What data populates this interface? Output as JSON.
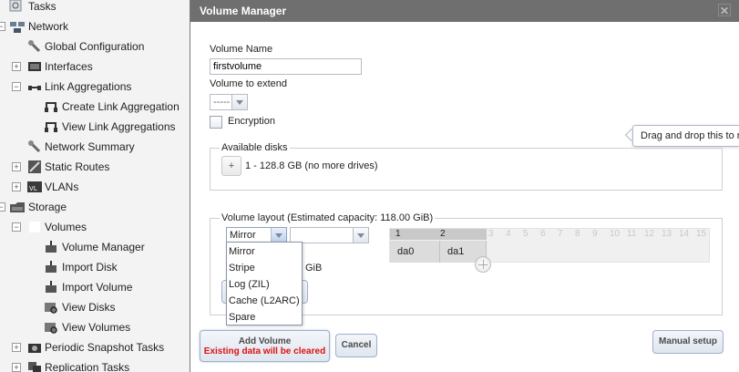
{
  "tree": {
    "items": [
      {
        "label": "Tasks",
        "icon": "tasks-icon"
      },
      {
        "label": "Network",
        "icon": "network-icon"
      },
      {
        "label": "Global Configuration",
        "icon": "wrench-icon"
      },
      {
        "label": "Interfaces",
        "icon": "interfaces-icon"
      },
      {
        "label": "Link Aggregations",
        "icon": "link-aggregation-icon"
      },
      {
        "label": "Create Link Aggregation",
        "icon": "create-link-icon"
      },
      {
        "label": "View Link Aggregations",
        "icon": "view-link-icon"
      },
      {
        "label": "Network Summary",
        "icon": "wrench-icon"
      },
      {
        "label": "Static Routes",
        "icon": "static-routes-icon"
      },
      {
        "label": "VLANs",
        "icon": "vlan-icon"
      },
      {
        "label": "Storage",
        "icon": "storage-icon"
      },
      {
        "label": "Volumes",
        "icon": "volumes-icon"
      },
      {
        "label": "Volume Manager",
        "icon": "volume-manager-icon"
      },
      {
        "label": "Import Disk",
        "icon": "import-disk-icon"
      },
      {
        "label": "Import Volume",
        "icon": "import-volume-icon"
      },
      {
        "label": "View Disks",
        "icon": "view-disks-icon"
      },
      {
        "label": "View Volumes",
        "icon": "view-volumes-icon"
      },
      {
        "label": "Periodic Snapshot Tasks",
        "icon": "snapshot-icon"
      },
      {
        "label": "Replication Tasks",
        "icon": "replication-icon"
      }
    ]
  },
  "dialog": {
    "title": "Volume Manager",
    "volume_name_label": "Volume Name",
    "volume_name_value": "firstvolume",
    "extend_label": "Volume to extend",
    "extend_value": "-----",
    "encryption_label": "Encryption",
    "tooltip": "Drag and drop this to resize",
    "available_disks_legend": "Available disks",
    "available_disks_add": "+",
    "available_disks_text": "1 - 128.8 GB (no more drives)",
    "layout_legend": "Volume layout (Estimated capacity: 118.00 GiB)",
    "layout_type_value": "Mirror",
    "layout_size_value": "",
    "capacity_partial": "GiB",
    "layout_options": [
      "Mirror",
      "Stripe",
      "Log (ZIL)",
      "Cache (L2ARC)",
      "Spare"
    ],
    "grid_columns": [
      "1",
      "2",
      "3",
      "4",
      "5",
      "6",
      "7",
      "8",
      "9",
      "10",
      "11",
      "12",
      "13",
      "14",
      "15"
    ],
    "grid_disks": [
      "da0",
      "da1"
    ],
    "add_volume_label": "Add Volume",
    "add_volume_warning": "Existing data will be cleared",
    "cancel_label": "Cancel",
    "manual_setup_label": "Manual setup"
  },
  "colors": {
    "titlebar": "#6f6f6f",
    "warning": "#dd1111",
    "button_border": "#9fb0c8"
  }
}
